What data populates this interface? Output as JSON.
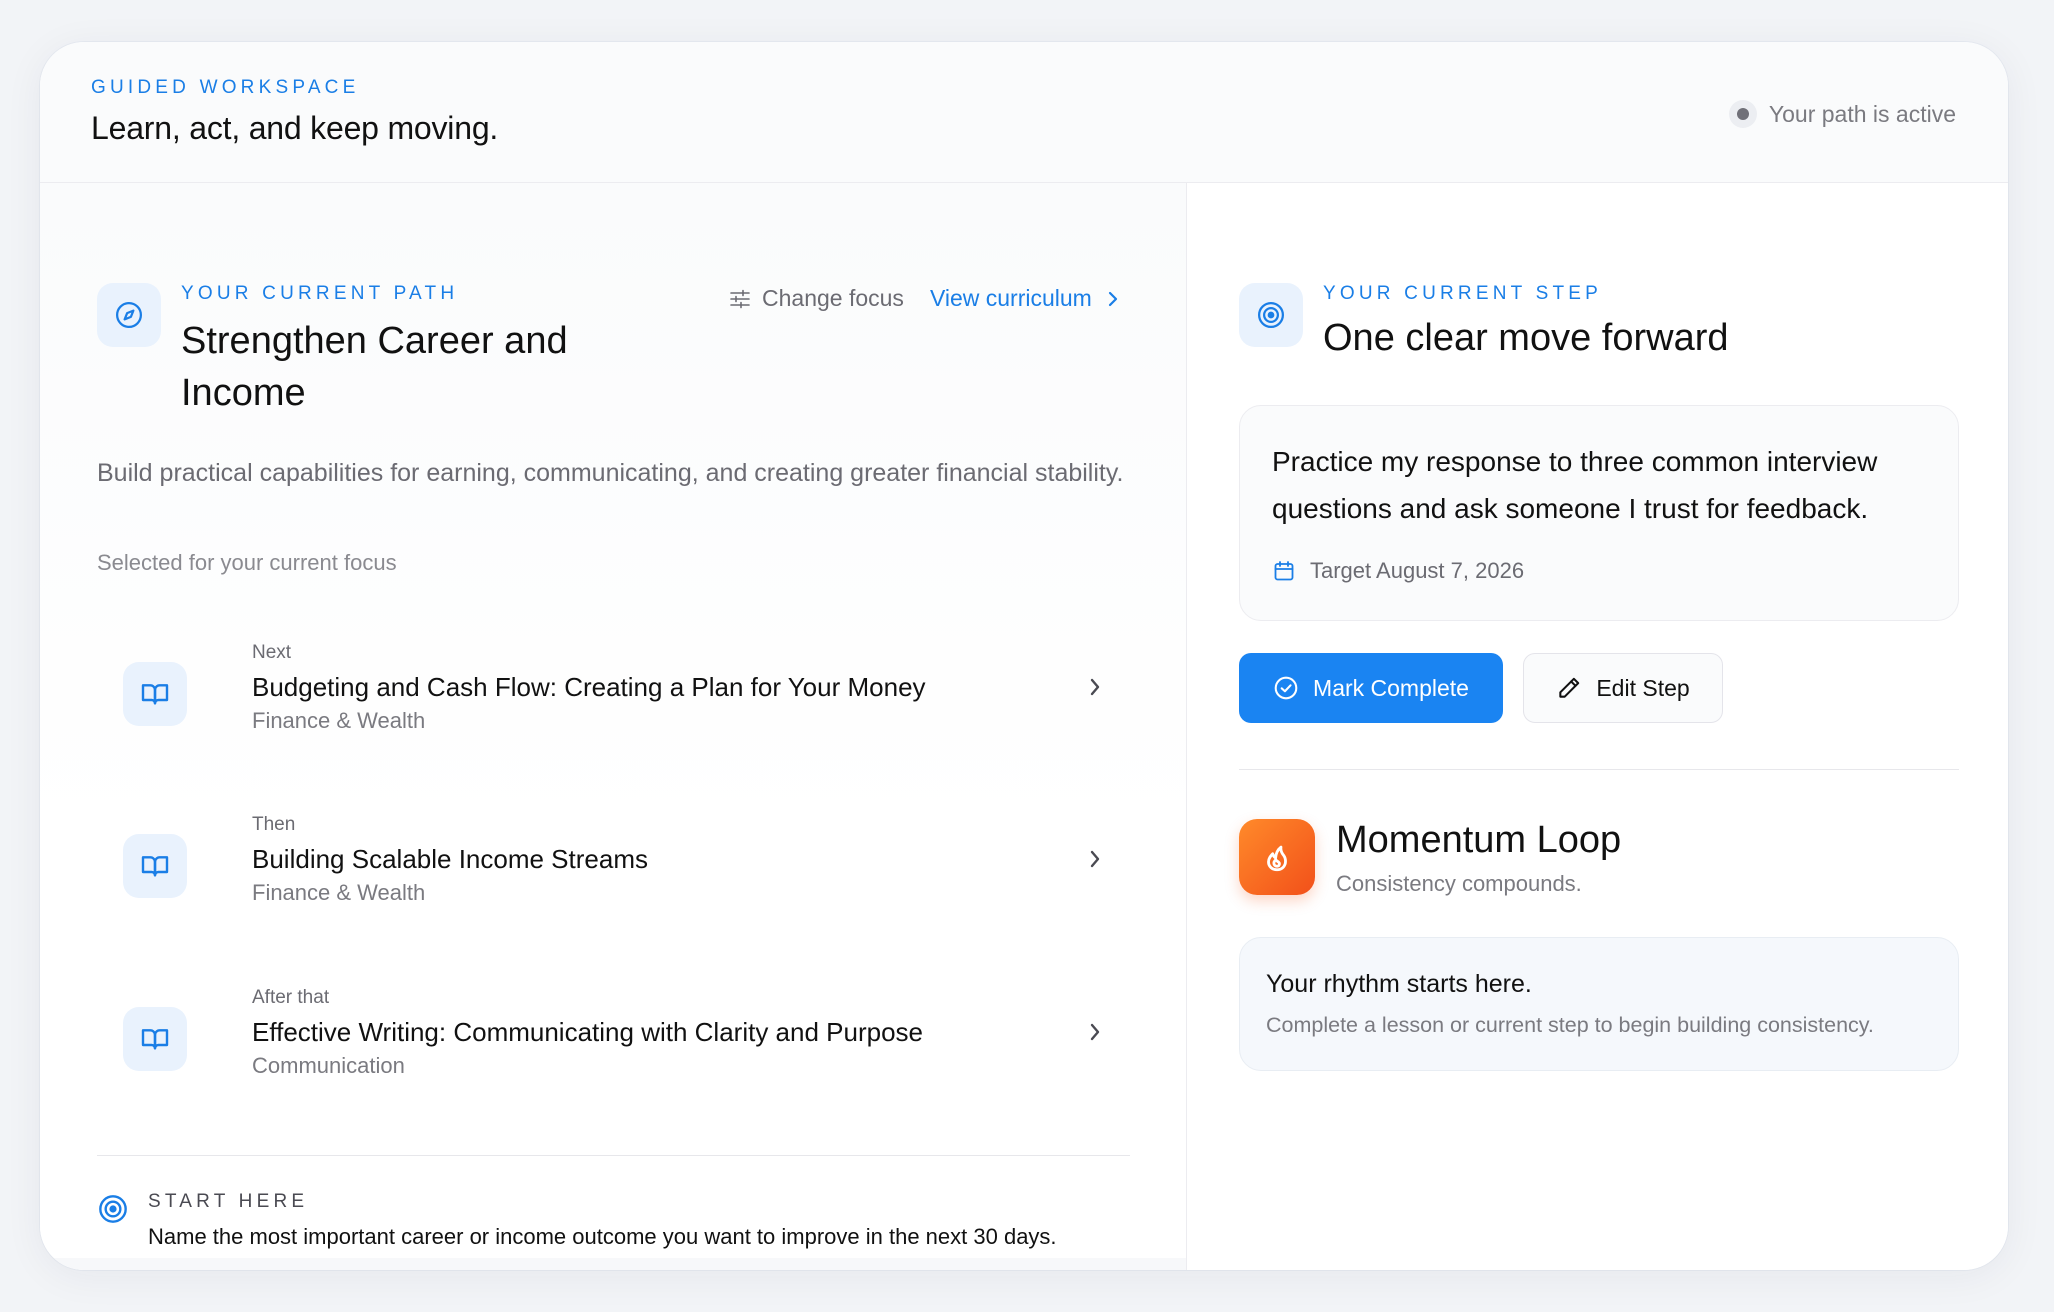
{
  "header": {
    "eyebrow": "GUIDED WORKSPACE",
    "title": "Learn, act, and keep moving.",
    "status": "Your path is active"
  },
  "path": {
    "eyebrow": "YOUR CURRENT PATH",
    "title": "Strengthen Career and Income",
    "change_focus": "Change focus",
    "view_curriculum": "View curriculum",
    "description": "Build practical capabilities for earning, communicating, and creating greater financial stability.",
    "subtitle": "Selected for your current focus",
    "lessons": [
      {
        "kicker": "Next",
        "title": "Budgeting and Cash Flow: Creating a Plan for Your Money",
        "category": "Finance & Wealth"
      },
      {
        "kicker": "Then",
        "title": "Building Scalable Income Streams",
        "category": "Finance & Wealth"
      },
      {
        "kicker": "After that",
        "title": "Effective Writing: Communicating with Clarity and Purpose",
        "category": "Communication"
      }
    ],
    "start_eyebrow": "START HERE",
    "start_text": "Name the most important career or income outcome you want to improve in the next 30 days."
  },
  "step": {
    "eyebrow": "YOUR CURRENT STEP",
    "title": "One clear move forward",
    "text": "Practice my response to three common interview questions and ask someone I trust for feedback.",
    "target": "Target August 7, 2026",
    "mark_complete": "Mark Complete",
    "edit_step": "Edit Step"
  },
  "momentum": {
    "title": "Momentum Loop",
    "subtitle": "Consistency compounds.",
    "rhythm_title": "Your rhythm starts here.",
    "rhythm_text": "Complete a lesson or current step to begin building consistency."
  },
  "colors": {
    "accent": "#1a7ee6",
    "primary_button": "#1a84f2",
    "flame_start": "#ff8a2a",
    "flame_end": "#f2501a"
  },
  "icons": {
    "path": "compass-icon",
    "step": "target-icon",
    "lesson": "book-icon",
    "change_focus": "sliders-icon",
    "target_date": "calendar-icon",
    "mark_complete": "check-circle-icon",
    "edit": "pencil-icon",
    "momentum": "flame-icon",
    "start": "target-icon"
  }
}
